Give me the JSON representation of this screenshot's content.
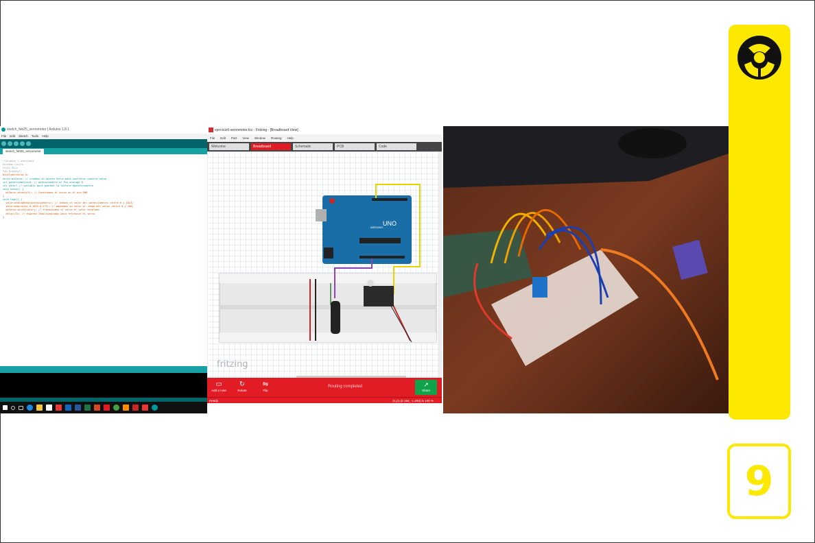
{
  "page": {
    "number": "9"
  },
  "arduino_ide": {
    "title": "sketch_feb25_servomotor | Arduino 1.8.1",
    "menu": [
      "File",
      "Edit",
      "Sketch",
      "Tools",
      "Help"
    ],
    "tab": "sketch_feb25_servomotor",
    "code": [
      "/*Alumnos 2 avanzados",
      "Esteban Castro",
      "Cuzco Ruiz",
      "Fab Academy*/",
      "",
      "#include<Servo.h>",
      "Servo miServo; // creamos un objeto Servo para controlar nuestro servo",
      "int potenciometro=0; // potenciometro al Pin analogo 0",
      "int valor; // variable para guardar la lectura @potenciometro",
      "",
      "",
      "void setup() {",
      "  miServo.attach(9); // Conectamos el servo en el pin PWM",
      "",
      "}",
      "",
      "void loop() {",
      "  valor=analogRead(potenciometro); // leemos el valor del potenciometro (entre 0 y 1023)",
      "  valor=map(valor,0,1023,0,179); // mapeamos su valor al rango del servo (entre 0 y 180)",
      "  miServo.write(valor); // trasmitimos al servo el valor escalado",
      "  delay(15); // esperan 15milisegundos para refrescar el servo",
      "",
      "}"
    ]
  },
  "fritzing": {
    "title": "ejercicio6-servomotor.fzz - Fritzing - [Breadboard View]",
    "menu": [
      "File",
      "Edit",
      "Part",
      "View",
      "Window",
      "Routing",
      "Help"
    ],
    "tabs": [
      "Welcome",
      "Breadboard",
      "Schematic",
      "PCB",
      "Code"
    ],
    "active_tab": "Breadboard",
    "logo": "fritzing",
    "board_label": "UNO",
    "arduino_text": "ARDUINO",
    "buttons": {
      "add_note": "Add a note",
      "rotate": "Rotate",
      "flip": "Flip",
      "share": "Share"
    },
    "routing_status": "Routing completed",
    "status": "Ready",
    "coords": "(x,y)=(2.164, -1.293) in",
    "zoom": "100 %"
  },
  "colors": {
    "yellow": "#fde800",
    "fritzing_red": "#e21c24",
    "arduino_teal": "#00979c",
    "share_green": "#10a34a"
  }
}
